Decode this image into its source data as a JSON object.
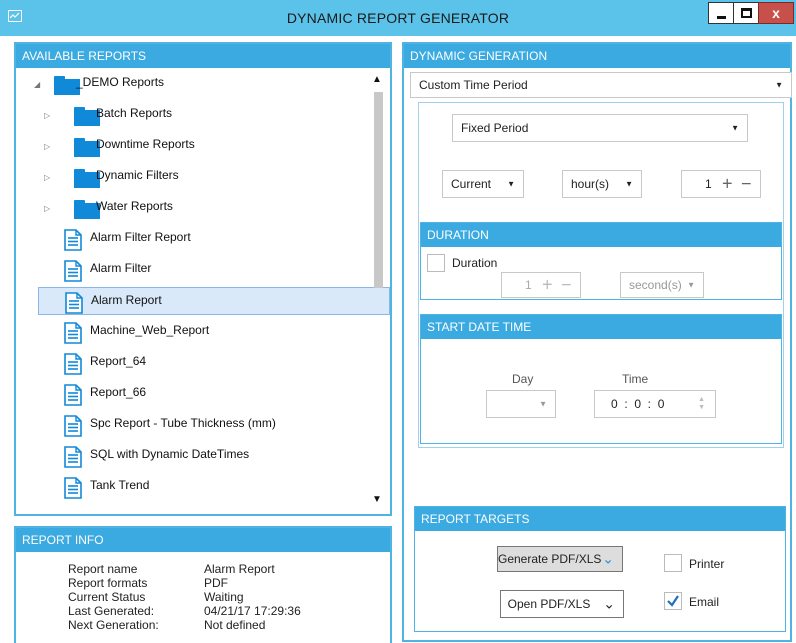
{
  "window": {
    "title": "DYNAMIC REPORT GENERATOR",
    "close_label": "x"
  },
  "available_reports": {
    "header": "AVAILABLE REPORTS",
    "tree": [
      {
        "label": "_DEMO Reports",
        "kind": "folder",
        "expanded": true,
        "level": 0
      },
      {
        "label": "Batch Reports",
        "kind": "folder",
        "expanded": false,
        "level": 1
      },
      {
        "label": "Downtime Reports",
        "kind": "folder",
        "expanded": false,
        "level": 1
      },
      {
        "label": "Dynamic Filters",
        "kind": "folder",
        "expanded": false,
        "level": 1
      },
      {
        "label": "Water Reports",
        "kind": "folder",
        "expanded": false,
        "level": 1
      },
      {
        "label": "Alarm Filter Report",
        "kind": "report",
        "level": 1
      },
      {
        "label": "Alarm Filter",
        "kind": "report",
        "level": 1
      },
      {
        "label": "Alarm Report",
        "kind": "report",
        "level": 1,
        "selected": true
      },
      {
        "label": "Machine_Web_Report",
        "kind": "report",
        "level": 1
      },
      {
        "label": "Report_64",
        "kind": "report",
        "level": 1
      },
      {
        "label": "Report_66",
        "kind": "report",
        "level": 1
      },
      {
        "label": "Spc Report - Tube Thickness (mm)",
        "kind": "report",
        "level": 1
      },
      {
        "label": "SQL with Dynamic DateTimes",
        "kind": "report",
        "level": 1
      },
      {
        "label": "Tank Trend",
        "kind": "report",
        "level": 1
      }
    ]
  },
  "report_info": {
    "header": "REPORT INFO",
    "rows": [
      {
        "label": "Report name",
        "value": "Alarm Report"
      },
      {
        "label": "Report formats",
        "value": "PDF"
      },
      {
        "label": "Current Status",
        "value": "Waiting"
      },
      {
        "label": "Last Generated:",
        "value": "04/21/17 17:29:36"
      },
      {
        "label": "Next Generation:",
        "value": "Not defined"
      }
    ]
  },
  "dynamic_generation": {
    "header": "DYNAMIC GENERATION",
    "time_mode": "Custom Time Period",
    "period_type": "Fixed Period",
    "relative": "Current",
    "unit": "hour(s)",
    "count": "1",
    "duration": {
      "header": "DURATION",
      "checkbox_label": "Duration",
      "checked": false,
      "count": "1",
      "unit": "second(s)"
    },
    "start_date_time": {
      "header": "START DATE TIME",
      "day_label": "Day",
      "time_label": "Time",
      "day_value": "",
      "time_value": "0  :  0  :  0"
    }
  },
  "report_targets": {
    "header": "REPORT TARGETS",
    "generate": "Generate PDF/XLS",
    "open": "Open PDF/XLS",
    "printer_label": "Printer",
    "printer_checked": false,
    "email_label": "Email",
    "email_checked": true
  },
  "colors": {
    "titlebar": "#5bc2ea",
    "header": "#3aaae0",
    "folder": "#1189d9",
    "selection": "#d9e9fa"
  }
}
